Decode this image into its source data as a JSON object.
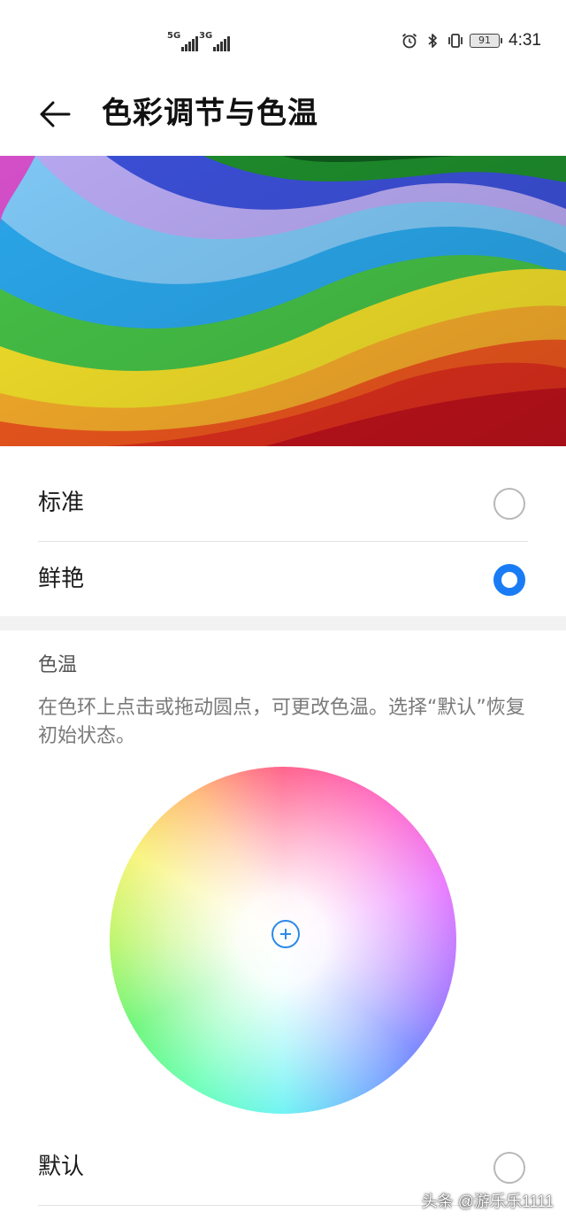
{
  "status_bar": {
    "sim1_tag": "5G",
    "sim2_tag": "3G",
    "battery": "91",
    "time": "4:31",
    "icons": [
      "alarm-icon",
      "bluetooth-icon",
      "vibrate-icon"
    ]
  },
  "header": {
    "title": "色彩调节与色温"
  },
  "color_modes": [
    {
      "label": "标准",
      "selected": false
    },
    {
      "label": "鲜艳",
      "selected": true
    }
  ],
  "color_temperature": {
    "title": "色温",
    "description": "在色环上点击或拖动圆点，可更改色温。选择“默认”恢复初始状态。"
  },
  "default_option": {
    "label": "默认",
    "selected": false
  },
  "watermark": "头条 @游乐乐1111",
  "colors": {
    "accent": "#1a7cf5",
    "radio_border": "#b8b8b8",
    "divider": "#e3e3e3"
  }
}
